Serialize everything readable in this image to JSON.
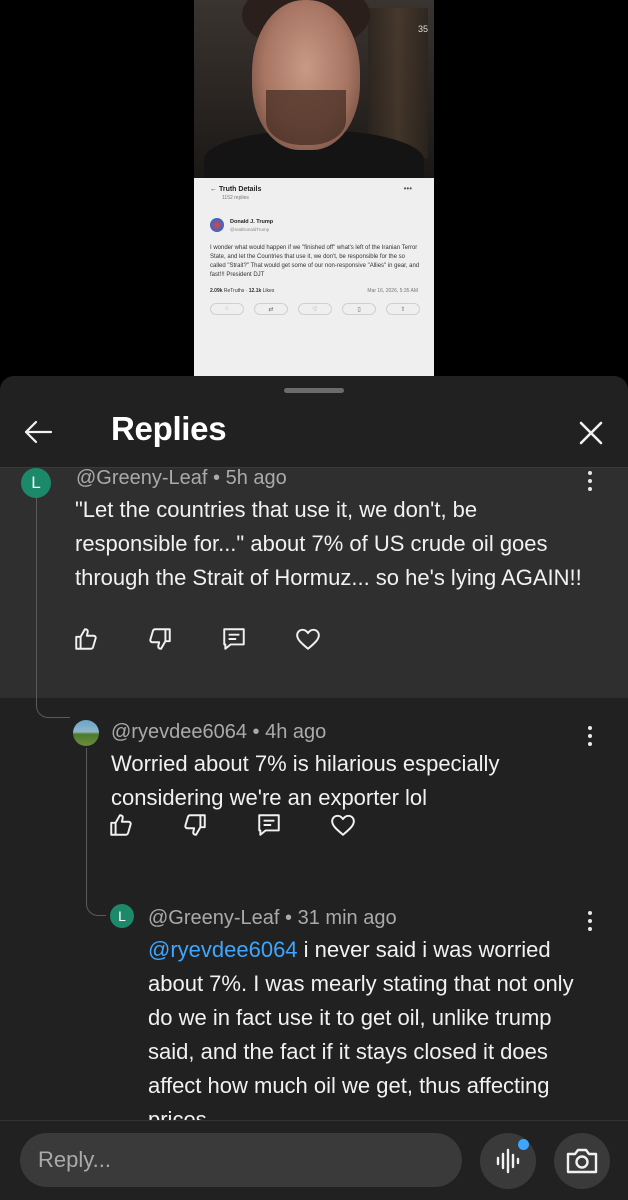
{
  "video": {
    "clock": "35",
    "post": {
      "header": "Truth Details",
      "replies": "1152 replies",
      "author": "Donald J. Trump",
      "handle": "@realDonaldTrump",
      "text": "I wonder what would happen if we \"finished off\" what's left of the Iranian Terror State, and let the Countries that use it, we don't, be responsible for the so called \"Strait?\" That would get some of our non-responsive \"Allies\" in gear, and fast!!! President DJT",
      "retruths": "2.09k",
      "retruths_label": "ReTruths",
      "likes": "12.1k",
      "likes_label": "Likes",
      "date": "Mar 16, 2026, 5:35 AM"
    }
  },
  "sheet": {
    "title": "Replies"
  },
  "comments": [
    {
      "avatar": "L",
      "author": "@Greeny-Leaf",
      "time": "5h ago",
      "text": "\"Let the countries that use it, we don't, be responsible for...\" about 7% of US crude oil goes through the Strait of Hormuz... so he's lying AGAIN!!"
    },
    {
      "author": "@ryevdee6064",
      "time": "4h ago",
      "text": "Worried about 7% is hilarious especially considering we're an exporter lol"
    },
    {
      "avatar": "L",
      "author": "@Greeny-Leaf",
      "time": "31 min ago",
      "mention": "@ryevdee6064",
      "text": " i never said i was worried about 7%. I was mearly stating that not only do we in fact use it to get oil, unlike trump said, and the fact if it stays closed it does affect how much oil we get, thus affecting prices"
    }
  ],
  "meta_separator": "•",
  "reply_box": {
    "placeholder": "Reply..."
  },
  "colors": {
    "accent": "#3ea6ff",
    "avatar_green": "#1c8a6a",
    "sheet_bg": "#212121",
    "highlight_bg": "#2f2f2f"
  }
}
